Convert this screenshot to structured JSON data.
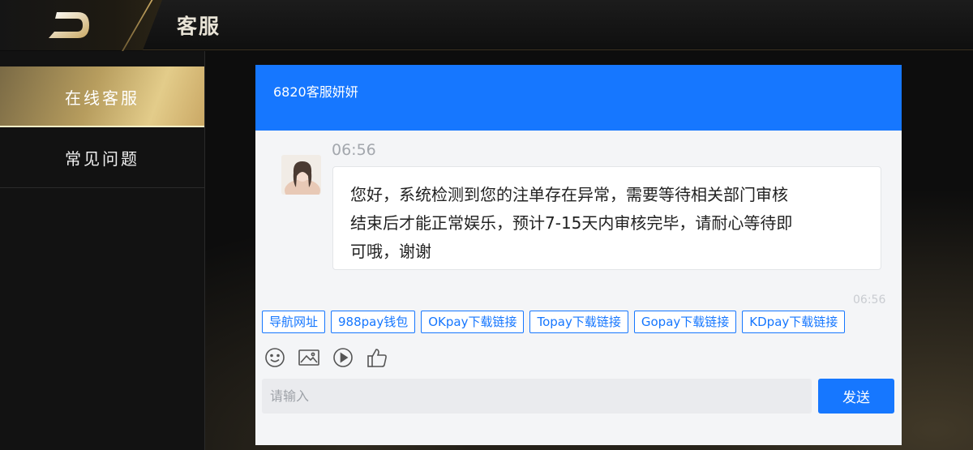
{
  "header": {
    "title": "客服"
  },
  "sidebar": {
    "items": [
      {
        "label": "在线客服",
        "active": true
      },
      {
        "label": "常见问题",
        "active": false
      }
    ]
  },
  "chat": {
    "agent_name": "6820客服妍妍",
    "messages": [
      {
        "time": "06:56",
        "lines": [
          "您好，系统检测到您的注单存在异常，需要等待相关部门审核",
          "结束后才能正常娱乐，预计7-15天内审核完毕，请耐心等待即",
          "可哦，谢谢"
        ]
      },
      {
        "time": "06:56"
      }
    ],
    "quick_links": [
      "导航网址",
      "988pay钱包",
      "OKpay下载链接",
      "Topay下载链接",
      "Gopay下载链接",
      "KDpay下载链接"
    ],
    "toolbar_icons": [
      "emoji-icon",
      "image-icon",
      "video-icon",
      "thumbs-up-icon"
    ],
    "input_placeholder": "请输入",
    "send_label": "发送"
  },
  "colors": {
    "accent": "#1677ff",
    "gold": "#c9a862",
    "background": "#0c0c0c"
  }
}
